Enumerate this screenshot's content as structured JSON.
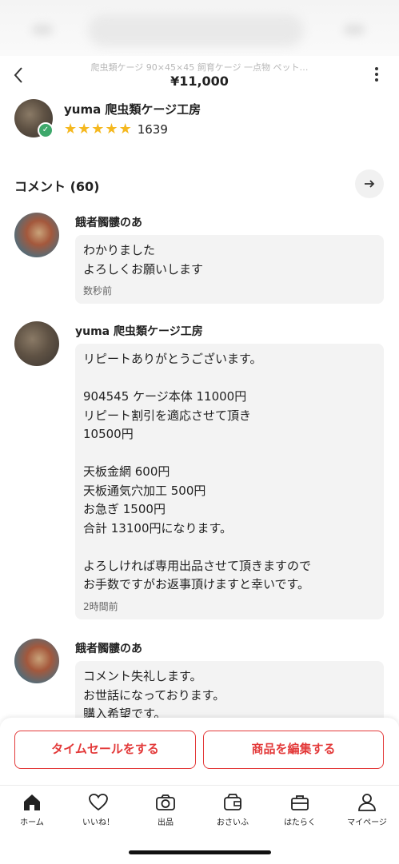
{
  "header": {
    "subtitle": "爬虫類ケージ 90×45×45 飼育ケージ 一点物 ペット…",
    "price": "¥11,000"
  },
  "seller": {
    "name": "yuma 爬虫類ケージ工房",
    "rating": 5,
    "rating_count": "1639"
  },
  "comments_section": {
    "title": "コメント (60)"
  },
  "comments": [
    {
      "name": "餓者髑髏のあ",
      "text": "わかりました\nよろしくお願いします",
      "time": "数秒前"
    },
    {
      "name": "yuma 爬虫類ケージ工房",
      "text": "リピートありがとうございます。\n\n904545 ケージ本体 11000円\nリピート割引を適応させて頂き\n10500円\n\n天板金網 600円\n天板通気穴加工 500円\nお急ぎ 1500円\n合計 13100円になります。\n\nよろしければ専用出品させて頂きますので\nお手数ですがお返事頂けますと幸いです。",
      "time": "2時間前"
    },
    {
      "name": "餓者髑髏のあ",
      "text": "コメント失礼します。\nお世話になっております。\n購入希望です。",
      "time": ""
    }
  ],
  "actions": {
    "timesale": "タイムセールをする",
    "edit": "商品を編集する"
  },
  "tabs": [
    {
      "label": "ホーム",
      "icon": "home-icon"
    },
    {
      "label": "いいね！",
      "icon": "heart-icon"
    },
    {
      "label": "出品",
      "icon": "camera-icon"
    },
    {
      "label": "おさいふ",
      "icon": "wallet-icon"
    },
    {
      "label": "はたらく",
      "icon": "briefcase-icon"
    },
    {
      "label": "マイページ",
      "icon": "person-icon"
    }
  ],
  "colors": {
    "accent": "#e33a3a",
    "star": "#f5b81f",
    "verified": "#3ea86b"
  }
}
